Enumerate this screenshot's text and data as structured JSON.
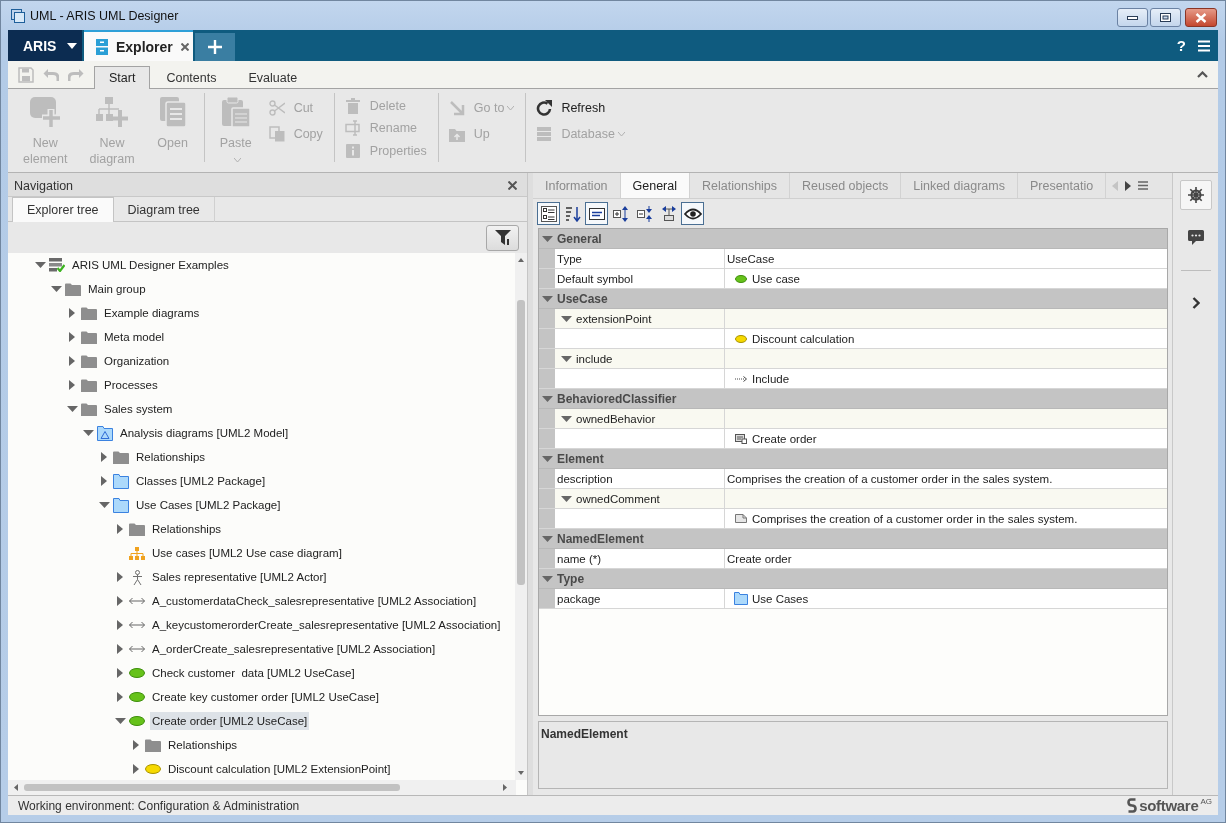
{
  "window": {
    "title": "UML - ARIS UML Designer"
  },
  "app_bar": {
    "product": "ARIS",
    "tabs": [
      {
        "label": "Explorer",
        "selected": true
      }
    ],
    "help": "?"
  },
  "ribbon": {
    "quick_access": [
      {
        "kind": "save",
        "disabled": true
      },
      {
        "kind": "undo",
        "disabled": true
      },
      {
        "kind": "redo",
        "disabled": true
      }
    ],
    "tabs": [
      {
        "label": "Start",
        "selected": true
      },
      {
        "label": "Contents",
        "selected": false
      },
      {
        "label": "Evaluate",
        "selected": false
      }
    ],
    "groups": [
      {
        "items": [
          {
            "label": "New element",
            "kind": "new-element",
            "large": true,
            "disabled": true,
            "dropdown": true
          },
          {
            "label": "New diagram",
            "kind": "new-diagram",
            "large": true,
            "disabled": true,
            "dropdown": true
          },
          {
            "label": "Open",
            "kind": "open",
            "large": true,
            "disabled": true,
            "dropdown": false
          }
        ]
      },
      {
        "items": [
          {
            "label": "Paste",
            "kind": "paste",
            "large": true,
            "disabled": true,
            "dropdown": true
          },
          {
            "label": "Cut",
            "kind": "cut",
            "large": false,
            "disabled": true,
            "dropdown": false
          },
          {
            "label": "Copy",
            "kind": "copy",
            "large": false,
            "disabled": true,
            "dropdown": false
          }
        ]
      },
      {
        "items": [
          {
            "label": "Delete",
            "kind": "delete",
            "large": false,
            "disabled": true,
            "dropdown": false
          },
          {
            "label": "Rename",
            "kind": "rename",
            "large": false,
            "disabled": true,
            "dropdown": false
          },
          {
            "label": "Properties",
            "kind": "properties",
            "large": false,
            "disabled": true,
            "dropdown": false
          }
        ]
      },
      {
        "items": [
          {
            "label": "Go to",
            "kind": "goto",
            "large": false,
            "disabled": true,
            "dropdown": true
          },
          {
            "label": "Up",
            "kind": "up",
            "large": false,
            "disabled": true,
            "dropdown": false
          }
        ]
      },
      {
        "items": [
          {
            "label": "Refresh",
            "kind": "refresh",
            "large": false,
            "disabled": false,
            "dropdown": false
          },
          {
            "label": "Database",
            "kind": "database",
            "large": false,
            "disabled": true,
            "dropdown": true
          }
        ]
      }
    ]
  },
  "navigation": {
    "title": "Navigation",
    "tabs": [
      {
        "label": "Explorer tree",
        "selected": true
      },
      {
        "label": "Diagram tree",
        "selected": false
      }
    ],
    "tree": [
      {
        "label": "ARIS UML Designer Examples",
        "kind": "database",
        "expanded": true,
        "selected": false,
        "children": [
          {
            "label": "Main group",
            "kind": "folder",
            "expanded": true,
            "selected": false,
            "children": [
              {
                "label": "Example diagrams",
                "kind": "folder",
                "expanded": false,
                "selected": false
              },
              {
                "label": "Meta model",
                "kind": "folder",
                "expanded": false,
                "selected": false
              },
              {
                "label": "Organization",
                "kind": "folder",
                "expanded": false,
                "selected": false
              },
              {
                "label": "Processes",
                "kind": "folder",
                "expanded": false,
                "selected": false
              },
              {
                "label": "Sales system",
                "kind": "folder",
                "expanded": true,
                "selected": false,
                "children": [
                  {
                    "label": "Analysis diagrams [UML2 Model]",
                    "kind": "model",
                    "expanded": true,
                    "selected": false,
                    "children": [
                      {
                        "label": "Relationships",
                        "kind": "folder",
                        "expanded": false,
                        "selected": false
                      },
                      {
                        "label": "Classes [UML2 Package]",
                        "kind": "package",
                        "expanded": false,
                        "selected": false
                      },
                      {
                        "label": "Use Cases [UML2 Package]",
                        "kind": "package",
                        "expanded": true,
                        "selected": false,
                        "children": [
                          {
                            "label": "Relationships",
                            "kind": "folder",
                            "expanded": false,
                            "selected": false
                          },
                          {
                            "label": "Use cases [UML2 Use case diagram]",
                            "kind": "diagram",
                            "selected": false
                          },
                          {
                            "label": "Sales representative [UML2 Actor]",
                            "kind": "actor",
                            "expanded": false,
                            "selected": false
                          },
                          {
                            "label": "A_customerdataCheck_salesrepresentative [UML2 Association]",
                            "kind": "association",
                            "expanded": false,
                            "selected": false
                          },
                          {
                            "label": "A_keycustomerorderCreate_salesrepresentative [UML2 Association]",
                            "kind": "association",
                            "expanded": false,
                            "selected": false
                          },
                          {
                            "label": "A_orderCreate_salesrepresentative [UML2 Association]",
                            "kind": "association",
                            "expanded": false,
                            "selected": false
                          },
                          {
                            "label": "Check customer  data [UML2 UseCase]",
                            "kind": "usecase",
                            "expanded": false,
                            "selected": false
                          },
                          {
                            "label": "Create key customer order [UML2 UseCase]",
                            "kind": "usecase",
                            "expanded": false,
                            "selected": false
                          },
                          {
                            "label": "Create order [UML2 UseCase]",
                            "kind": "usecase",
                            "expanded": true,
                            "selected": true,
                            "children": [
                              {
                                "label": "Relationships",
                                "kind": "folder",
                                "expanded": false,
                                "selected": false
                              },
                              {
                                "label": "Discount calculation [UML2 ExtensionPoint]",
                                "kind": "extensionpoint",
                                "expanded": false,
                                "selected": false
                              }
                            ]
                          }
                        ]
                      }
                    ]
                  }
                ]
              }
            ]
          }
        ]
      }
    ]
  },
  "properties": {
    "tabs": [
      {
        "label": "Information",
        "selected": false
      },
      {
        "label": "General",
        "selected": true
      },
      {
        "label": "Relationships",
        "selected": false
      },
      {
        "label": "Reused objects",
        "selected": false
      },
      {
        "label": "Linked diagrams",
        "selected": false
      },
      {
        "label": "Presentatio",
        "selected": false
      }
    ],
    "tab_nav": [
      {
        "kind": "left",
        "disabled": true
      },
      {
        "kind": "right",
        "disabled": false
      }
    ],
    "toolbar": [
      {
        "kind": "categorized",
        "pressed": true
      },
      {
        "kind": "sort",
        "pressed": false
      },
      {
        "kind": "description",
        "pressed": true
      },
      {
        "kind": "expand",
        "pressed": false
      },
      {
        "kind": "collapse",
        "pressed": false
      },
      {
        "kind": "connector",
        "pressed": false
      },
      {
        "kind": "preview",
        "pressed": true
      }
    ],
    "sections": [
      {
        "name": "General",
        "expanded": true,
        "rows": [
          {
            "kind": "text",
            "name": "Type",
            "value": "UseCase"
          },
          {
            "kind": "usecase",
            "name": "Default symbol",
            "value": "Use case"
          }
        ]
      },
      {
        "name": "UseCase",
        "expanded": true,
        "rows": [
          {
            "kind": "group",
            "name": "extensionPoint",
            "expanded": true,
            "children": [
              {
                "kind": "extensionpoint",
                "value": "Discount calculation"
              }
            ]
          },
          {
            "kind": "group",
            "name": "include",
            "expanded": true,
            "children": [
              {
                "kind": "include",
                "value": "Include"
              }
            ]
          }
        ]
      },
      {
        "name": "BehavioredClassifier",
        "expanded": true,
        "rows": [
          {
            "kind": "group",
            "name": "ownedBehavior",
            "expanded": true,
            "children": [
              {
                "kind": "behavior",
                "value": "Create order"
              }
            ]
          }
        ]
      },
      {
        "name": "Element",
        "expanded": true,
        "rows": [
          {
            "kind": "text",
            "name": "description",
            "value": "Comprises the creation of a customer order in the sales system."
          },
          {
            "kind": "group",
            "name": "ownedComment",
            "expanded": true,
            "children": [
              {
                "kind": "comment",
                "value": "Comprises the creation of a customer order in the sales system."
              }
            ]
          }
        ]
      },
      {
        "name": "NamedElement",
        "expanded": true,
        "rows": [
          {
            "kind": "text",
            "name": "name (*)",
            "value": "Create order"
          }
        ]
      },
      {
        "name": "Type",
        "expanded": true,
        "rows": [
          {
            "kind": "package",
            "name": "package",
            "value": "Use Cases"
          }
        ]
      }
    ],
    "description": {
      "title": "NamedElement"
    }
  },
  "sidebar": {
    "buttons": [
      {
        "kind": "wheel",
        "selected": true
      },
      {
        "kind": "comments",
        "selected": false
      }
    ]
  },
  "status_bar": {
    "text": "Working environment: Configuration & Administration",
    "logo": {
      "name": "software",
      "suffix": "AG"
    }
  }
}
